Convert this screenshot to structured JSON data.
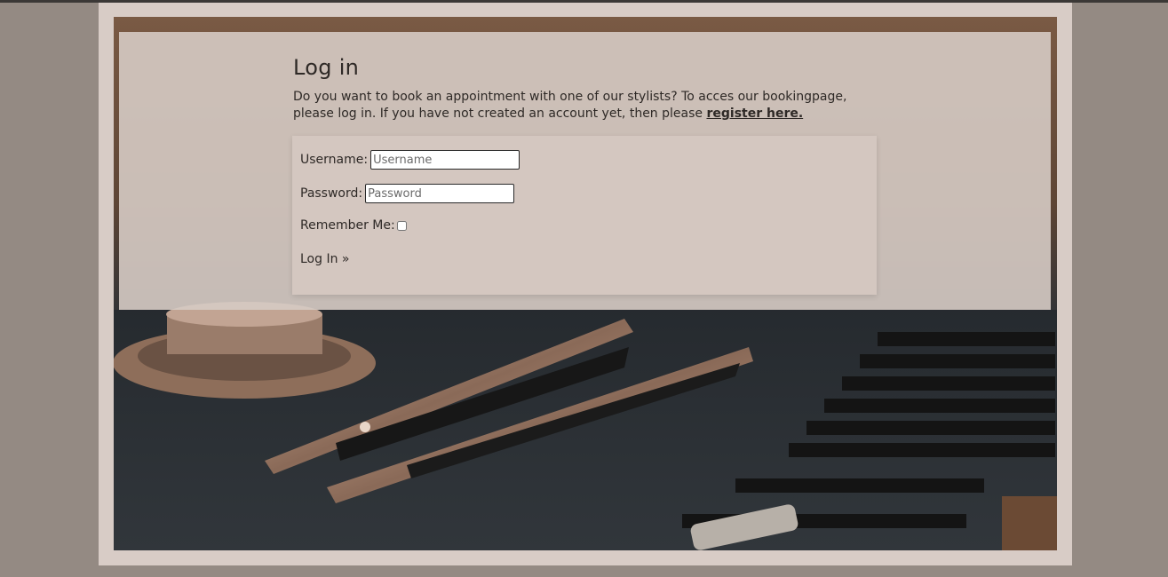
{
  "page": {
    "heading": "Log in",
    "intro_text": "Do you want to book an appointment with one of our stylists? To acces our bookingpage, please log in. If you have not created an account yet, then please ",
    "register_link": "register here."
  },
  "form": {
    "username_label": "Username:",
    "username_placeholder": "Username",
    "password_label": "Password:",
    "password_placeholder": "Password",
    "remember_label": "Remember Me:",
    "remember_checked": false,
    "submit_label": "Log In »"
  },
  "colors": {
    "page_bg": "#948a83",
    "frame_bg": "#d8ccc6",
    "panel_bg": "#d6cbc4",
    "text": "#2e2926"
  }
}
